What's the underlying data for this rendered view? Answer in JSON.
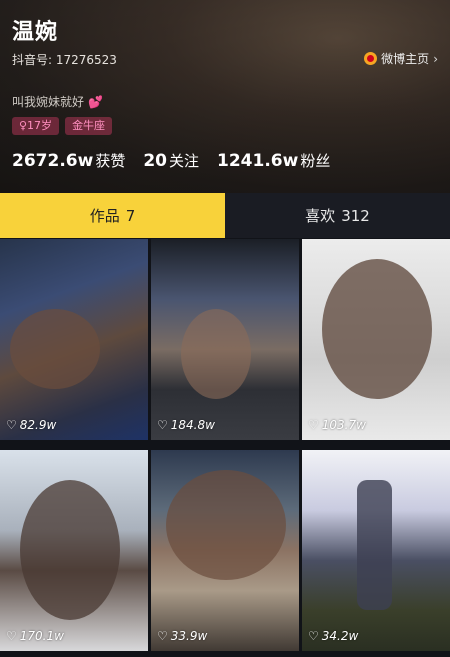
{
  "profile": {
    "name": "温婉",
    "douyin_id": "抖音号: 17276523",
    "weibo_label": "微博主页",
    "bio": "叫我婉妹就好",
    "tags": [
      "♀17岁",
      "金牛座"
    ],
    "stats": [
      {
        "num": "2672.6w",
        "label": "获赞"
      },
      {
        "num": "20",
        "label": "关注"
      },
      {
        "num": "1241.6w",
        "label": "粉丝"
      }
    ]
  },
  "tabs": [
    {
      "label": "作品",
      "count": "7"
    },
    {
      "label": "喜欢",
      "count": "312"
    }
  ],
  "videos": [
    {
      "likes": "82.9w"
    },
    {
      "likes": "184.8w"
    },
    {
      "likes": "103.7w"
    },
    {
      "likes": "170.1w"
    },
    {
      "likes": "33.9w"
    },
    {
      "likes": "34.2w"
    }
  ],
  "colors": {
    "accent": "#f8d23a",
    "tag_text": "#ff8fbf",
    "background": "#111318"
  }
}
